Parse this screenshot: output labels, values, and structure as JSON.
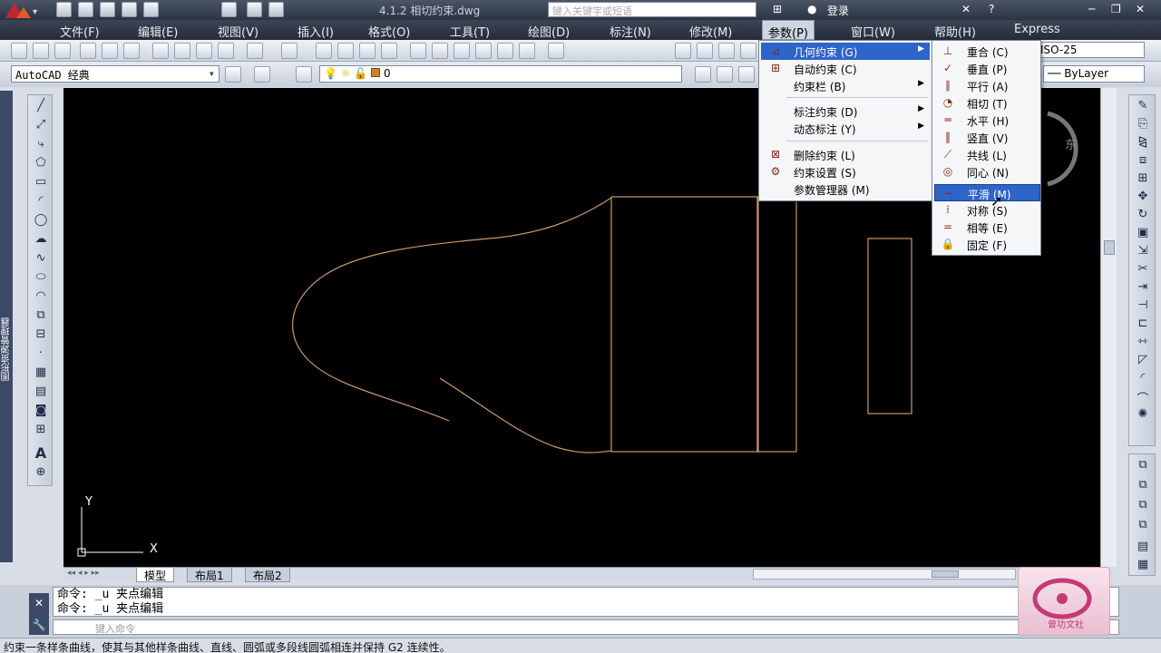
{
  "title": {
    "doc": "4.1.2 相切约束.dwg",
    "search_placeholder": "键入关键字或短语",
    "login": "登录"
  },
  "menu": [
    "文件(F)",
    "编辑(E)",
    "视图(V)",
    "插入(I)",
    "格式(O)",
    "工具(T)",
    "绘图(D)",
    "标注(N)",
    "修改(M)",
    "参数(P)",
    "窗口(W)",
    "帮助(H)",
    "Express"
  ],
  "toolbar": {
    "workspace": "AutoCAD 经典",
    "layer": "0",
    "dimstyle": "ISO-25",
    "linetype": "ByLayer"
  },
  "param_menu": [
    {
      "label": "几何约束 (G)",
      "submenu": true,
      "highlight": true,
      "icon": "geometric-constraint-icon"
    },
    {
      "label": "自动约束 (C)",
      "submenu": false,
      "icon": "auto-constrain-icon"
    },
    {
      "label": "约束栏 (B)",
      "submenu": true,
      "icon": ""
    },
    {
      "sep": true
    },
    {
      "label": "标注约束 (D)",
      "submenu": true,
      "icon": ""
    },
    {
      "label": "动态标注 (Y)",
      "submenu": true,
      "icon": ""
    },
    {
      "sep": true
    },
    {
      "label": "删除约束 (L)",
      "submenu": false,
      "icon": "delete-constraints-icon"
    },
    {
      "label": "约束设置 (S)",
      "submenu": false,
      "icon": "constraint-settings-icon"
    },
    {
      "label": "参数管理器 (M)",
      "submenu": false,
      "icon": ""
    }
  ],
  "geo_menu": [
    {
      "label": "重合 (C)",
      "icon": "coincident-icon"
    },
    {
      "label": "垂直 (P)",
      "icon": "perpendicular-icon"
    },
    {
      "label": "平行 (A)",
      "icon": "parallel-icon"
    },
    {
      "label": "相切 (T)",
      "icon": "tangent-icon"
    },
    {
      "label": "水平 (H)",
      "icon": "horizontal-icon"
    },
    {
      "label": "竖直 (V)",
      "icon": "vertical-icon"
    },
    {
      "label": "共线 (L)",
      "icon": "collinear-icon"
    },
    {
      "label": "同心 (N)",
      "icon": "concentric-icon"
    },
    {
      "label": "平滑 (M)",
      "icon": "smooth-icon",
      "highlight": true
    },
    {
      "label": "对称 (S)",
      "icon": "symmetric-icon"
    },
    {
      "label": "相等 (E)",
      "icon": "equal-icon"
    },
    {
      "label": "固定 (F)",
      "icon": "fix-icon"
    }
  ],
  "tabs": [
    "模型",
    "布局1",
    "布局2"
  ],
  "side_palette_title": "图形资源管理器",
  "command_lines": [
    "命令: _u 夹点编辑",
    "命令: _u 夹点编辑"
  ],
  "command_prompt": "键入命令",
  "status": "约束一条样条曲线，使其与其他样条曲线、直线、圆弧或多段线圆弧相连并保持 G2 连续性。",
  "ucs": {
    "x": "X",
    "y": "Y"
  },
  "viewcube_label": "东",
  "logo_text": "曾功文社",
  "colors": {
    "drawing_bg": "#000000",
    "geometry": "#c89a6c",
    "highlight": "#2f64c8"
  }
}
